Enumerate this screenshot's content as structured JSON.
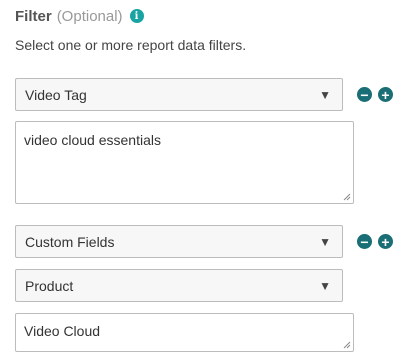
{
  "filter": {
    "title": "Filter",
    "optional_label": "(Optional)",
    "info_icon": "info-icon",
    "subtitle": "Select one or more report data filters."
  },
  "rows": [
    {
      "select_value": "Video Tag",
      "textarea_value": "video cloud essentials"
    },
    {
      "select_value": "Custom Fields",
      "sub_select_value": "Product",
      "textarea_value": "Video Cloud"
    }
  ],
  "icons": {
    "dropdown": "▼",
    "remove": "−",
    "add": "+"
  },
  "colors": {
    "accent": "#1a6e75",
    "info": "#1aa3a3"
  }
}
